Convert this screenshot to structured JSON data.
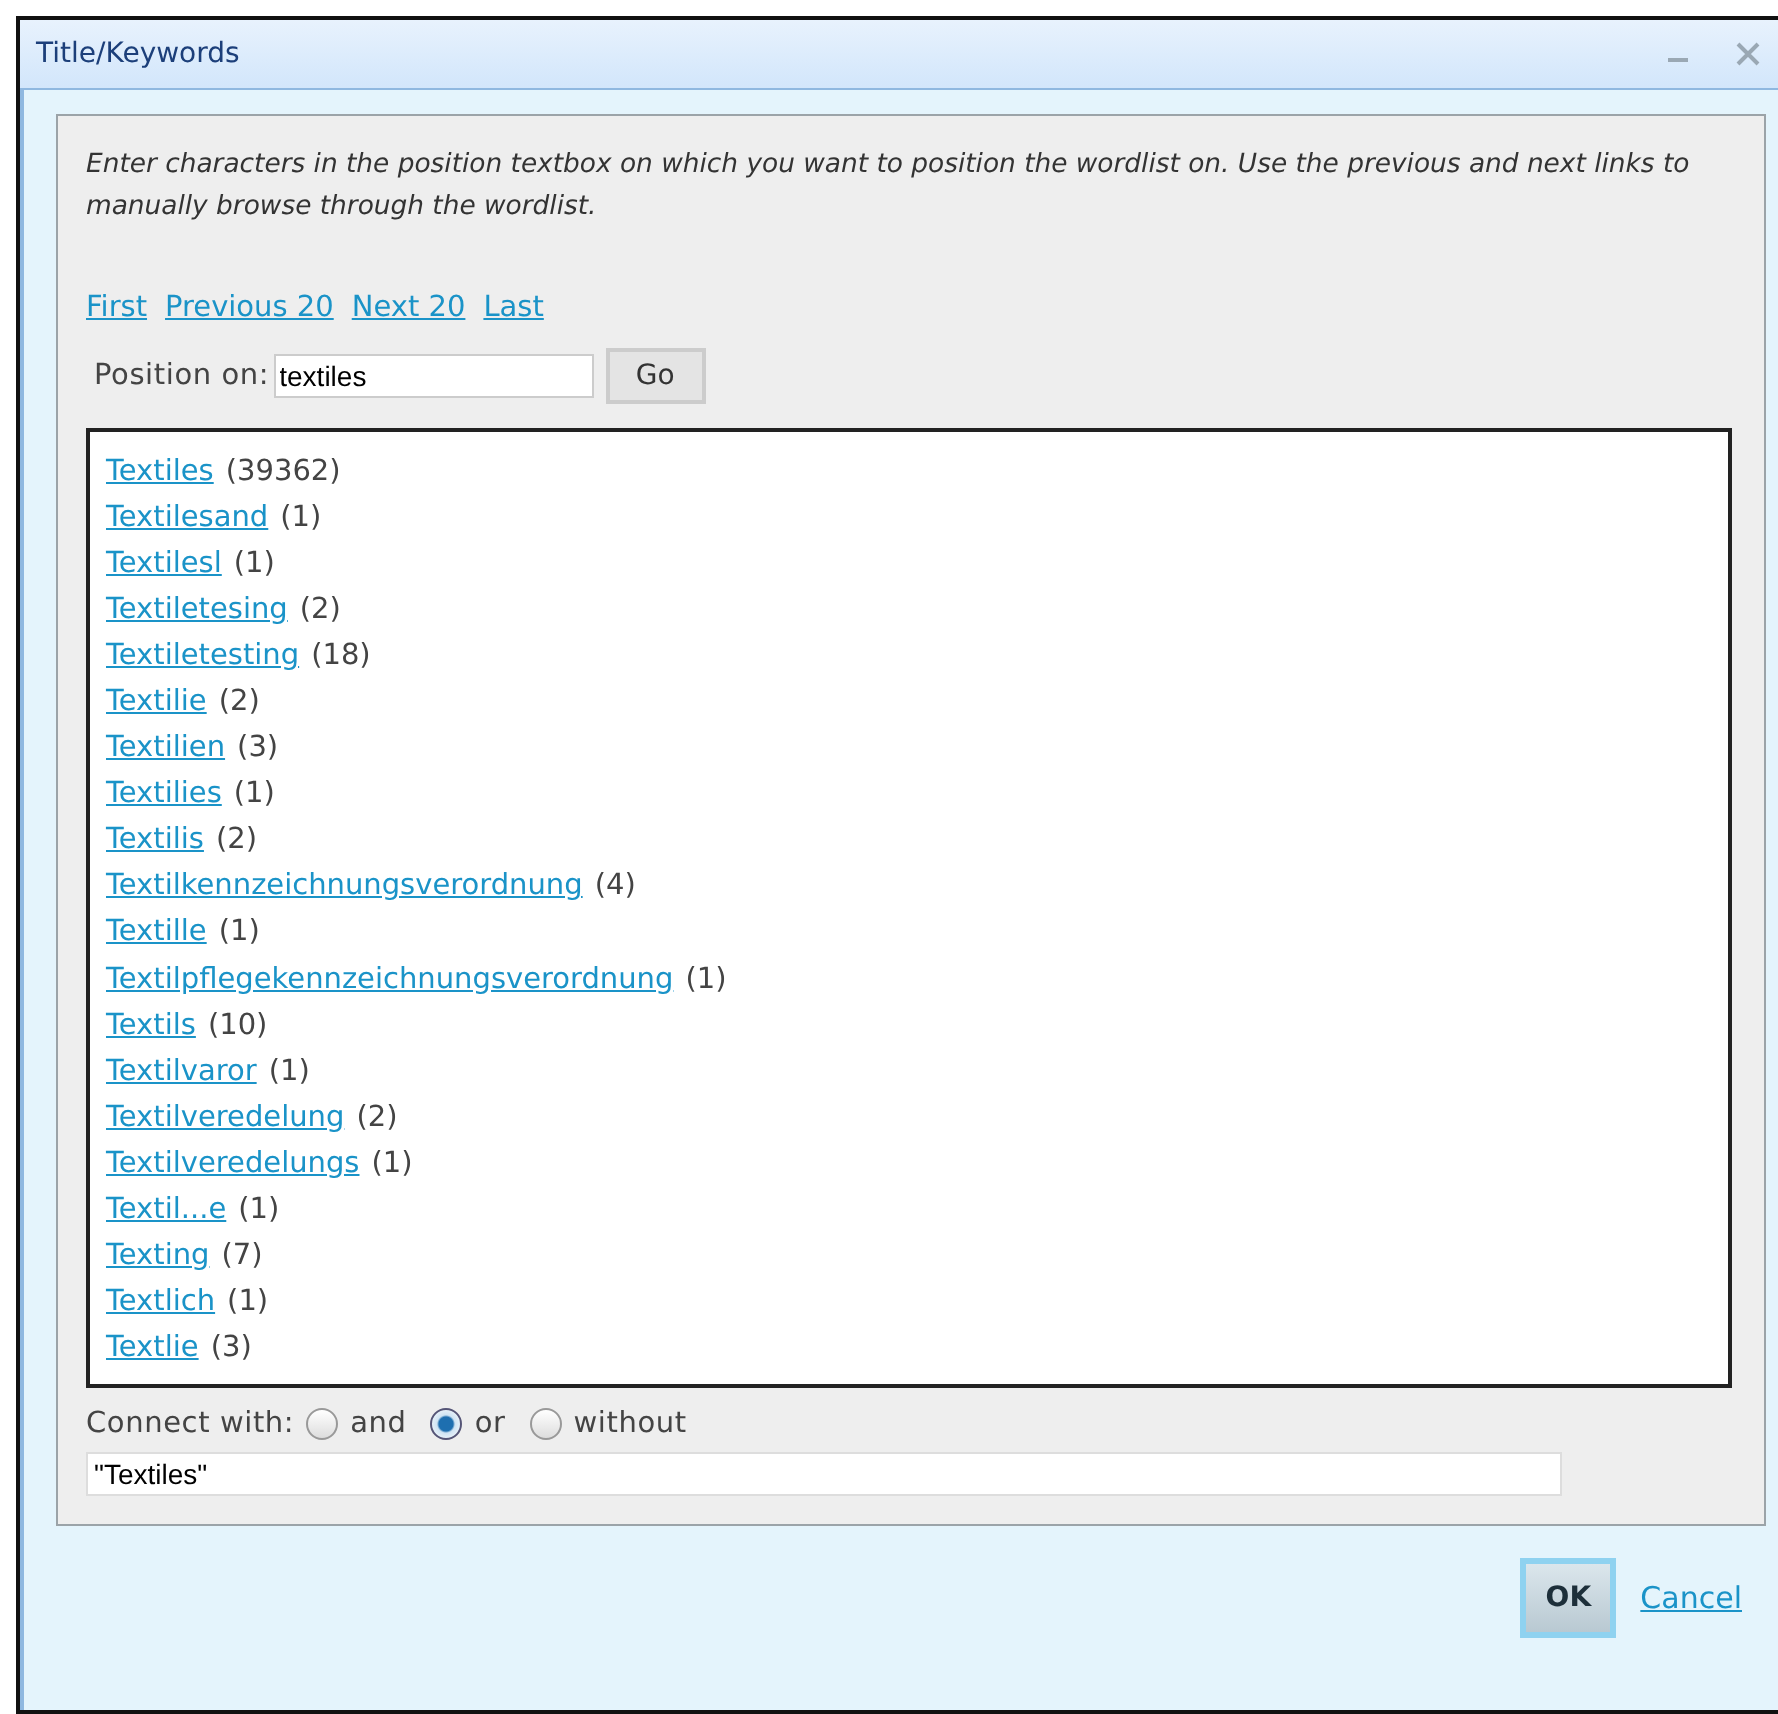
{
  "window": {
    "title": "Title/Keywords"
  },
  "instructions": "Enter characters in the position textbox on which you want to position the wordlist on. Use the previous and next links to manually browse through the wordlist.",
  "nav_links": [
    "First",
    "Previous 20",
    "Next 20",
    "Last"
  ],
  "position": {
    "label": "Position on:",
    "value": "textiles",
    "button": "Go"
  },
  "wordlist": [
    {
      "term": "Textiles",
      "count": "(39362)"
    },
    {
      "term": "Textilesand",
      "count": "(1)"
    },
    {
      "term": "Textilesl",
      "count": "(1)"
    },
    {
      "term": "Textiletesing",
      "count": "(2)"
    },
    {
      "term": "Textiletesting",
      "count": "(18)"
    },
    {
      "term": "Textilie",
      "count": "(2)"
    },
    {
      "term": "Textilien",
      "count": "(3)"
    },
    {
      "term": "Textilies",
      "count": "(1)"
    },
    {
      "term": "Textilis",
      "count": "(2)"
    },
    {
      "term": "Textilkennzeichnungsverordnung",
      "count": "(4)"
    },
    {
      "term": "Textille",
      "count": "(1)"
    },
    {
      "term": "Textilpflegekennzeichnungsverordnung",
      "count": "(1)"
    },
    {
      "term": "Textils",
      "count": "(10)"
    },
    {
      "term": "Textilvaror",
      "count": "(1)"
    },
    {
      "term": "Textilveredelung",
      "count": "(2)"
    },
    {
      "term": "Textilveredelungs",
      "count": "(1)"
    },
    {
      "term": "Textil...e",
      "count": "(1)"
    },
    {
      "term": "Texting",
      "count": "(7)"
    },
    {
      "term": "Textlich",
      "count": "(1)"
    },
    {
      "term": "Textlie",
      "count": "(3)"
    }
  ],
  "connect": {
    "label": "Connect with:",
    "options": [
      {
        "label": "and",
        "selected": false
      },
      {
        "label": "or",
        "selected": true
      },
      {
        "label": "without",
        "selected": false
      }
    ]
  },
  "query": {
    "value": "\"Textiles\""
  },
  "buttons": {
    "ok": "OK",
    "cancel": "Cancel"
  }
}
